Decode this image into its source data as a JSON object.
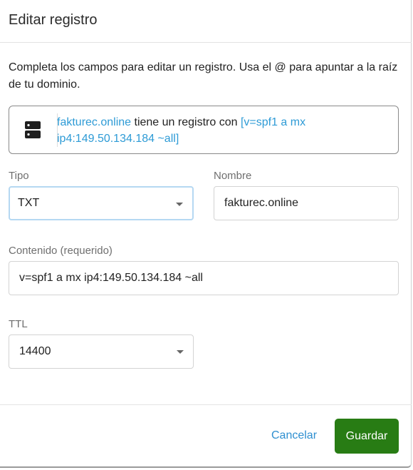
{
  "dialog": {
    "title": "Editar registro",
    "description": "Completa los campos para editar un registro. Usa el @ para apuntar a la raíz de tu dominio."
  },
  "info": {
    "icon": "server-icon",
    "domain": "fakturec.online",
    "middle_text": " tiene un registro con ",
    "record_value": "[v=spf1 a mx ip4:149.50.134.184 ~all]"
  },
  "form": {
    "type_label": "Tipo",
    "type_value": "TXT",
    "name_label": "Nombre",
    "name_value": "fakturec.online",
    "content_label": "Contenido (requerido)",
    "content_value": "v=spf1 a mx ip4:149.50.134.184 ~all",
    "ttl_label": "TTL",
    "ttl_value": "14400"
  },
  "footer": {
    "cancel_label": "Cancelar",
    "save_label": "Guardar"
  },
  "colors": {
    "accent_link": "#2e9bd6",
    "primary_button": "#287c14",
    "focus_border": "#b5d8f2"
  }
}
